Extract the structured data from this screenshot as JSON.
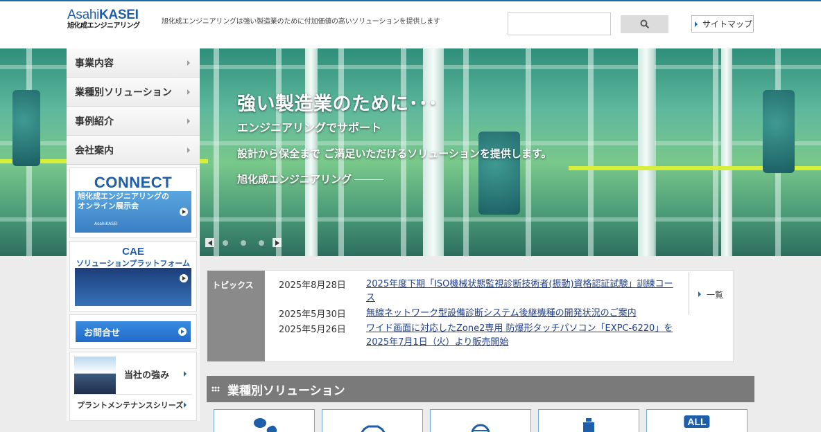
{
  "header": {
    "logo_top": "AsahiKASEI",
    "logo_top_a": "Asahi",
    "logo_top_b": "KASEI",
    "logo_bottom": "旭化成エンジニアリング",
    "tagline": "旭化成エンジニアリングは強い製造業のために付加価値の高いソリューションを提供します",
    "search_placeholder": "",
    "search_icon": "search-icon",
    "sitemap_label": "サイトマップ"
  },
  "hero": {
    "title": "強い製造業のために･･･",
    "subtitle": "エンジニアリングでサポート",
    "description": "設計から保全まで ご満足いただけるソリューションを提供します。",
    "company": "旭化成エンジニアリング"
  },
  "nav": {
    "items": [
      {
        "label": "事業内容"
      },
      {
        "label": "業種別ソリューション"
      },
      {
        "label": "事例紹介"
      },
      {
        "label": "会社案内"
      }
    ]
  },
  "banners": {
    "connect_title": "CONNECT",
    "connect_sub1": "旭化成エンジニアリングの",
    "connect_sub2": "オンライン展示会",
    "connect_logo": "AsahiKASEI",
    "cae_title": "CAE",
    "cae_sub": "ソリューションプラットフォーム",
    "contact_label": "お問合せ",
    "strength_label": "当社の強み",
    "plant_maintenance_label": "プラントメンテナンスシリーズ"
  },
  "topics": {
    "label": "トピックス",
    "all_label": "一覧",
    "items": [
      {
        "date": "2025年8月28日",
        "title": "2025年度下期「ISO機械状態監視診断技術者(振動)資格認証試験」訓練コース"
      },
      {
        "date": "2025年5月30日",
        "title": "無線ネットワーク型設備診断システム後継機種の開発状況のご案内"
      },
      {
        "date": "2025年5月26日",
        "title": "ワイド画面に対応したZone2専用 防爆形タッチパソコン「EXPC-6220」を2025年7月1日（火）より販売開始"
      }
    ]
  },
  "solutions": {
    "header": "業種別ソリューション",
    "all_badge": "ALL",
    "cards": [
      "pills-icon",
      "car-icon",
      "helmet-icon",
      "bottle-icon",
      "all-icon"
    ]
  },
  "colors": {
    "brand_blue": "#1f5ea8",
    "gray_header": "#7a7a7a",
    "link": "#1f3f8a"
  }
}
